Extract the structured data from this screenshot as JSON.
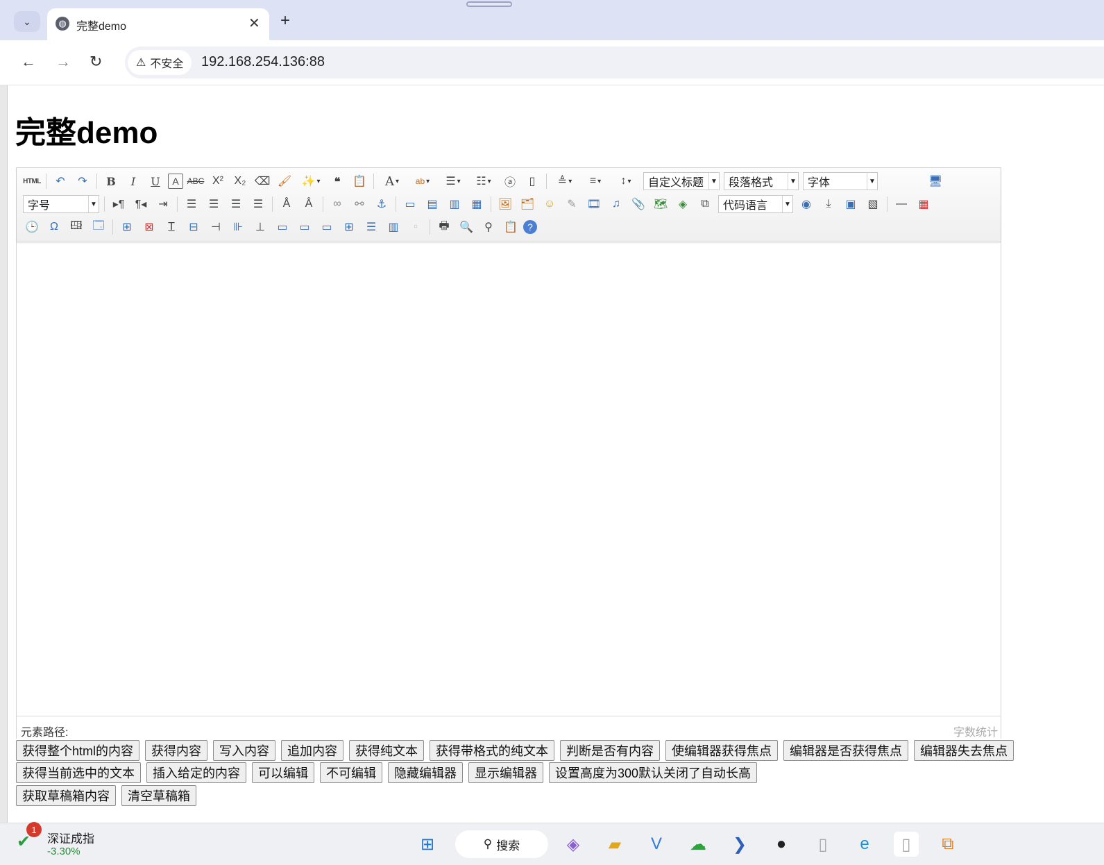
{
  "browser": {
    "tab_title": "完整demo",
    "security_label": "不安全",
    "url": "192.168.254.136:88"
  },
  "page": {
    "title": "完整demo"
  },
  "editor": {
    "combos": {
      "custom_heading": "自定义标题",
      "paragraph_format": "段落格式",
      "font_family": "字体",
      "font_size": "字号",
      "code_language": "代码语言"
    },
    "element_path_label": "元素路径:",
    "word_count_label": "字数统计"
  },
  "buttons_row1": [
    "获得整个html的内容",
    "获得内容",
    "写入内容",
    "追加内容",
    "获得纯文本",
    "获得带格式的纯文本",
    "判断是否有内容",
    "使编辑器获得焦点",
    "编辑器是否获得焦点",
    "编辑器失去焦点"
  ],
  "buttons_row2": [
    "获得当前选中的文本",
    "插入给定的内容",
    "可以编辑",
    "不可编辑",
    "隐藏编辑器",
    "显示编辑器",
    "设置高度为300默认关闭了自动长高"
  ],
  "buttons_row3": [
    "获取草稿箱内容",
    "清空草稿箱"
  ],
  "taskbar": {
    "stock_badge": "1",
    "stock_name": "深证成指",
    "stock_change": "-3.30%",
    "search_label": "搜索"
  }
}
